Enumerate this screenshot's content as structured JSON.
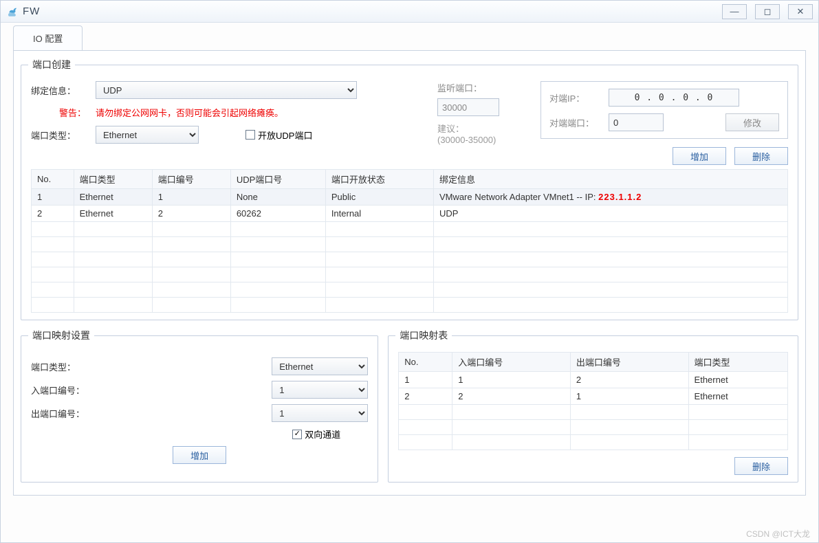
{
  "title": "FW",
  "tab": "IO 配置",
  "port_create": {
    "legend": "端口创建",
    "bind_label": "绑定信息：",
    "bind_sel": "UDP",
    "warn_label": "警告：",
    "warn_text": "请勿绑定公网网卡，否则可能会引起网络瘫痪。",
    "port_type_label": "端口类型：",
    "port_type_sel": "Ethernet",
    "open_udp_check_label": "开放UDP端口",
    "open_udp_checked": false,
    "listen_label": "监听端口：",
    "listen_val": "30000",
    "advice_label": "建议：",
    "advice_val": "(30000-35000)",
    "peer_ip_label": "对端IP：",
    "peer_ip_val": "0 . 0 . 0 . 0",
    "peer_port_label": "对端端口：",
    "peer_port_val": "0",
    "modify_btn": "修改",
    "add_btn": "增加",
    "del_btn": "删除",
    "headers": [
      "No.",
      "端口类型",
      "端口编号",
      "UDP端口号",
      "端口开放状态",
      "绑定信息"
    ],
    "rows": [
      {
        "no": "1",
        "type": "Ethernet",
        "pno": "1",
        "udp": "None",
        "status": "Public",
        "bind_prefix": "VMware Network Adapter VMnet1 -- IP:",
        "bind_ip": "223.1.1.2"
      },
      {
        "no": "2",
        "type": "Ethernet",
        "pno": "2",
        "udp": "60262",
        "status": "Internal",
        "bind_prefix": "UDP",
        "bind_ip": ""
      }
    ]
  },
  "map_set": {
    "legend": "端口映射设置",
    "type_label": "端口类型：",
    "type_sel": "Ethernet",
    "in_label": "入端口编号：",
    "in_sel": "1",
    "out_label": "出端口编号：",
    "out_sel": "1",
    "bi_label": "双向通道",
    "bi_checked": true,
    "add_btn": "增加"
  },
  "map_tbl": {
    "legend": "端口映射表",
    "headers": [
      "No.",
      "入端口编号",
      "出端口编号",
      "端口类型"
    ],
    "rows": [
      {
        "no": "1",
        "in": "1",
        "out": "2",
        "type": "Ethernet"
      },
      {
        "no": "2",
        "in": "2",
        "out": "1",
        "type": "Ethernet"
      }
    ],
    "del_btn": "删除"
  },
  "watermark": "CSDN @ICT大龙"
}
